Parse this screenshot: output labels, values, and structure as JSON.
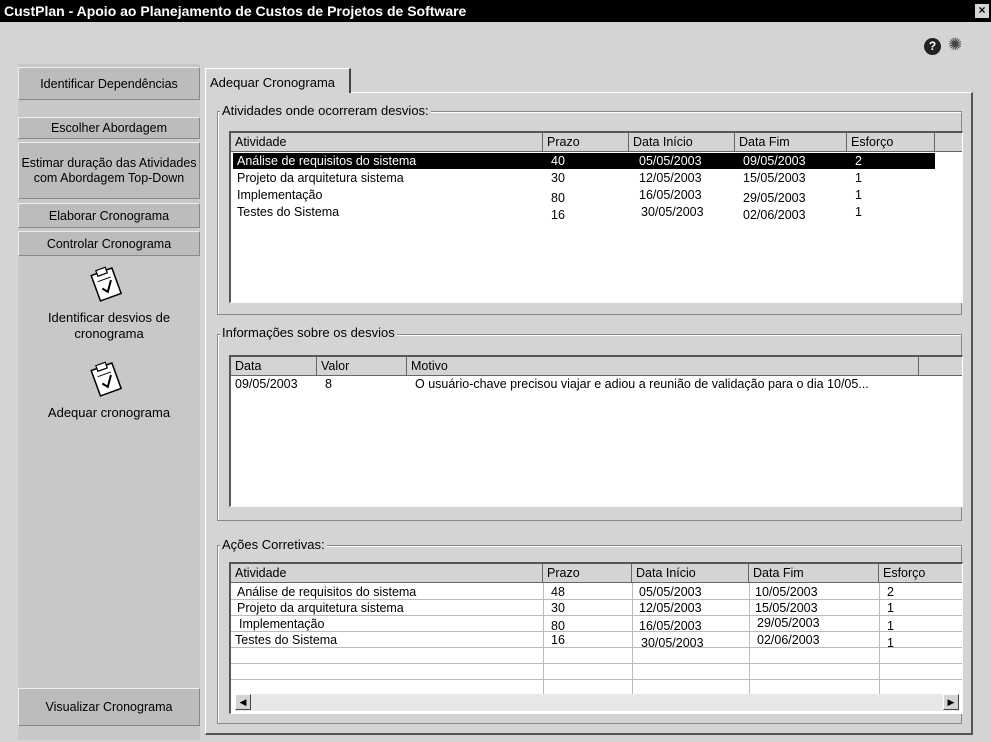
{
  "window": {
    "title": "CustPlan - Apoio ao Planejamento de Custos de Projetos de Software",
    "close_label": "×"
  },
  "toolbar_icons": {
    "help": "help-icon",
    "tip": "lightbulb-icon",
    "help_glyph": "?",
    "tip_glyph": "✺"
  },
  "sidebar": {
    "buttons": [
      "Identificar Dependências",
      "Escolher Abordagem",
      "Estimar duração das Atividades com Abordagem Top-Down",
      "Elaborar Cronograma",
      "Controlar Cronograma"
    ],
    "tasks": [
      "Identificar desvios de cronograma",
      "Adequar cronograma"
    ],
    "bottom_button": "Visualizar Cronograma"
  },
  "tab": {
    "label": "Adequar Cronograma"
  },
  "desvios": {
    "title": "Atividades onde ocorreram desvios:",
    "headers": [
      "Atividade",
      "Prazo",
      "Data Início",
      "Data Fim",
      "Esforço"
    ],
    "rows": [
      [
        "Análise de requisitos do sistema",
        "40",
        "05/05/2003",
        "09/05/2003",
        "2"
      ],
      [
        "Projeto da arquitetura sistema",
        "30",
        "12/05/2003",
        "15/05/2003",
        "1"
      ],
      [
        "Implementação",
        "80",
        "16/05/2003",
        "29/05/2003",
        "1"
      ],
      [
        "Testes do Sistema",
        "16",
        "30/05/2003",
        "02/06/2003",
        "1"
      ]
    ],
    "selected_row": 0
  },
  "info": {
    "title": "Informações sobre os desvios",
    "headers": [
      "Data",
      "Valor",
      "Motivo"
    ],
    "rows": [
      [
        "09/05/2003",
        "8",
        "O usuário-chave precisou viajar e adiou a reunião de validação para o dia 10/05..."
      ]
    ]
  },
  "acoes": {
    "title": "Ações Corretivas:",
    "headers": [
      "Atividade",
      "Prazo",
      "Data Início",
      "Data Fim",
      "Esforço"
    ],
    "rows": [
      [
        "Análise de requisitos do sistema",
        "48",
        "05/05/2003",
        "10/05/2003",
        "2"
      ],
      [
        "Projeto da arquitetura sistema",
        "30",
        "12/05/2003",
        "15/05/2003",
        "1"
      ],
      [
        "Implementação",
        "80",
        "16/05/2003",
        "29/05/2003",
        "1"
      ],
      [
        "Testes do Sistema",
        "16",
        "30/05/2003",
        "02/06/2003",
        "1"
      ]
    ],
    "scroll_left": "◀",
    "scroll_right": "▶"
  }
}
